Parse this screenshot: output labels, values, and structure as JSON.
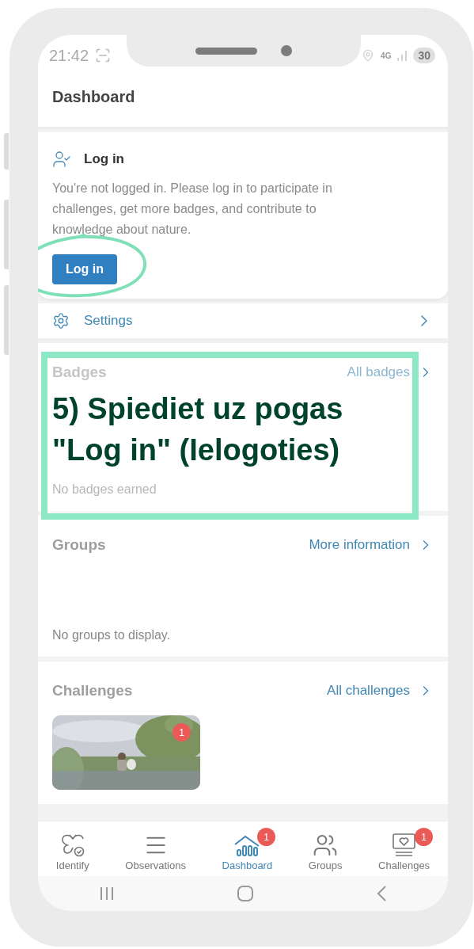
{
  "status_bar": {
    "time": "21:42",
    "network": "4G",
    "battery": "30"
  },
  "header": {
    "title": "Dashboard"
  },
  "login_card": {
    "title": "Log in",
    "message": "You're not logged in. Please log in to participate in challenges, get more badges, and contribute to knowledge about nature.",
    "button": "Log in"
  },
  "settings": {
    "label": "Settings"
  },
  "sections": [
    {
      "kind": "badges",
      "title": "Badges",
      "link": "All badges",
      "empty_text": "No badges earned"
    },
    {
      "kind": "groups",
      "title": "Groups",
      "link": "More information",
      "empty_text": "No groups to display."
    },
    {
      "kind": "challenges",
      "title": "Challenges",
      "link": "All challenges",
      "challenges": [
        {
          "kind": "picture",
          "badge": "1"
        }
      ]
    }
  ],
  "bottom_nav": [
    {
      "label": "Identify",
      "selected": false
    },
    {
      "label": "Observations",
      "selected": false
    },
    {
      "label": "Dashboard",
      "selected": true,
      "badge": "1"
    },
    {
      "label": "Groups",
      "selected": false
    },
    {
      "label": "Challenges",
      "selected": false,
      "badge": "1"
    }
  ],
  "annotation": {
    "text": "5) Spiediet uz pogas \"Log in\" (Ielogoties)"
  }
}
